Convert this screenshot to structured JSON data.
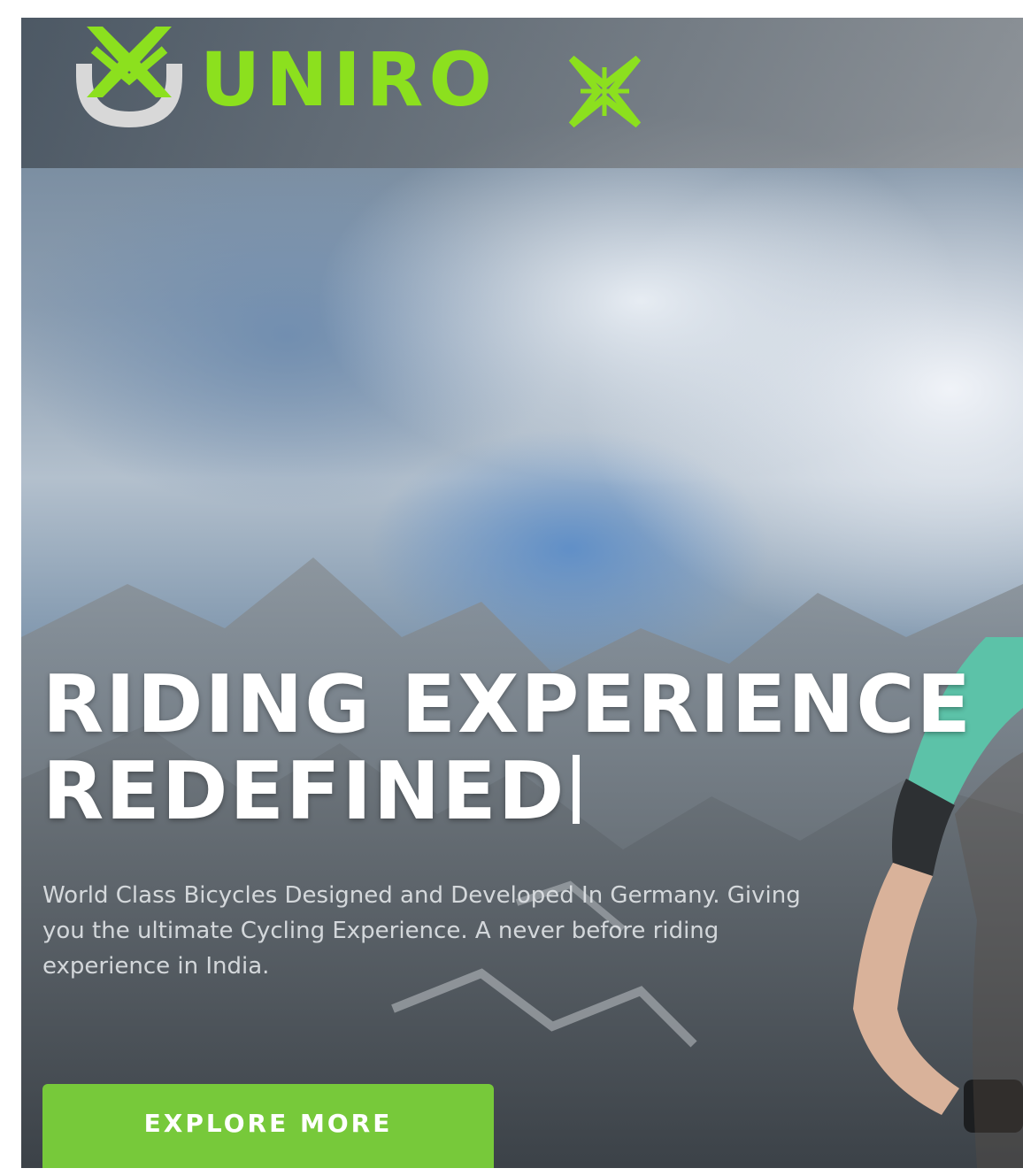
{
  "brand": {
    "name": "UNIRO",
    "accent_color": "#8ce01e",
    "logo_icon": "unirox-emblem-icon",
    "logo_x_icon": "x-star-icon"
  },
  "hero": {
    "headline_line1": "RIDING EXPERIENCE",
    "headline_line2": "REDEFINED",
    "description": "World Class Bicycles Designed and Developed In Germany. Giving you the ultimate Cycling Experience. A never before riding experience in India.",
    "cta_label": "EXPLORE MORE",
    "cta_color": "#77c93a"
  }
}
